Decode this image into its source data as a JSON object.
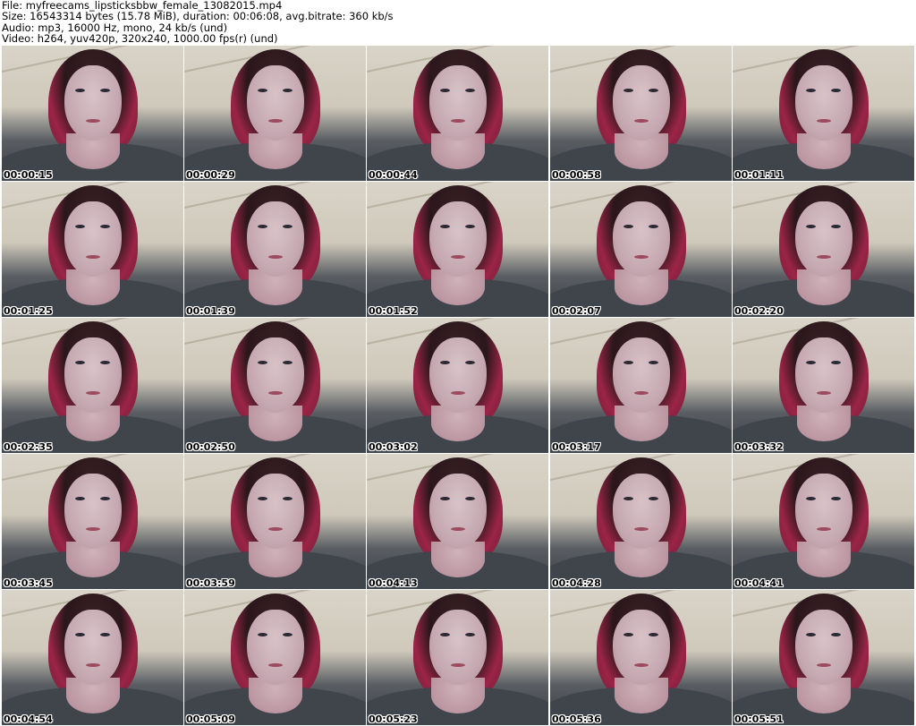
{
  "header": {
    "file": "File: myfreecams_lipsticksbbw_female_13082015.mp4",
    "size": "Size: 16543314 bytes (15.78 MiB), duration: 00:06:08, avg.bitrate: 360 kb/s",
    "audio": "Audio: mp3, 16000 Hz, mono, 24 kb/s (und)",
    "video": "Video: h264, yuv420p, 320x240, 1000.00 fps(r) (und)"
  },
  "thumbnails": [
    {
      "timestamp": "00:00:15"
    },
    {
      "timestamp": "00:00:29"
    },
    {
      "timestamp": "00:00:44"
    },
    {
      "timestamp": "00:00:58"
    },
    {
      "timestamp": "00:01:11"
    },
    {
      "timestamp": "00:01:25"
    },
    {
      "timestamp": "00:01:39"
    },
    {
      "timestamp": "00:01:52"
    },
    {
      "timestamp": "00:02:07"
    },
    {
      "timestamp": "00:02:20"
    },
    {
      "timestamp": "00:02:35"
    },
    {
      "timestamp": "00:02:50"
    },
    {
      "timestamp": "00:03:02"
    },
    {
      "timestamp": "00:03:17"
    },
    {
      "timestamp": "00:03:32"
    },
    {
      "timestamp": "00:03:45"
    },
    {
      "timestamp": "00:03:59"
    },
    {
      "timestamp": "00:04:13"
    },
    {
      "timestamp": "00:04:28"
    },
    {
      "timestamp": "00:04:41"
    },
    {
      "timestamp": "00:04:54"
    },
    {
      "timestamp": "00:05:09"
    },
    {
      "timestamp": "00:05:23"
    },
    {
      "timestamp": "00:05:36"
    },
    {
      "timestamp": "00:05:51"
    }
  ]
}
